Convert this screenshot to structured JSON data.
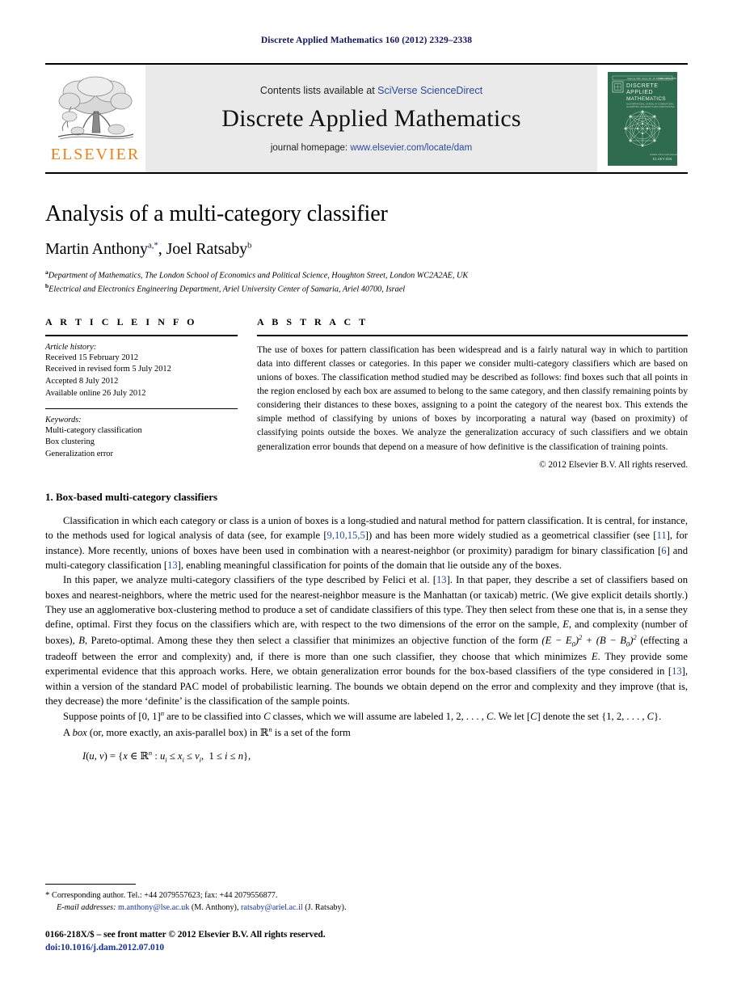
{
  "running_head": "Discrete Applied Mathematics 160 (2012) 2329–2338",
  "masthead": {
    "publisher_name": "ELSEVIER",
    "publisher_logo_icon": "elsevier-tree-icon",
    "contents_prefix": "Contents lists available at ",
    "contents_link": "SciVerse ScienceDirect",
    "journal_name": "Discrete Applied Mathematics",
    "homepage_prefix": "journal homepage: ",
    "homepage_link": "www.elsevier.com/locate/dam",
    "cover": {
      "issue_line": "Volume 160, Issue 16, 15 October 2012",
      "issn_line": "ISSN 0166-218X",
      "title_line1": "DISCRETE",
      "title_line2": "APPLIED",
      "title_line3": "MATHEMATICS",
      "subtitle": "AN INTERNATIONAL JOURNAL OF COMBINATORIAL ALGORITHMS, INFORMATICS AND COMPUTATIONAL SCIENCES",
      "footer": "ELSEVIER",
      "graphic_icon": "graph-network-icon",
      "bg_color": "#2f6b4f"
    }
  },
  "article": {
    "title": "Analysis of a multi-category classifier",
    "authors": [
      {
        "name": "Martin Anthony",
        "marks": "a,*"
      },
      {
        "name": "Joel Ratsaby",
        "marks": "b"
      }
    ],
    "authors_separator": ", ",
    "affiliations": [
      {
        "mark": "a",
        "text": "Department of Mathematics, The London School of Economics and Political Science, Houghton Street, London WC2A2AE, UK"
      },
      {
        "mark": "b",
        "text": "Electrical and Electronics Engineering Department, Ariel University Center of Samaria, Ariel 40700, Israel"
      }
    ]
  },
  "article_info": {
    "label": "A R T I C L E   I N F O",
    "history_label": "Article history:",
    "history": [
      "Received 15 February 2012",
      "Received in revised form 5 July 2012",
      "Accepted 8 July 2012",
      "Available online 26 July 2012"
    ],
    "keywords_label": "Keywords:",
    "keywords": [
      "Multi-category classification",
      "Box clustering",
      "Generalization error"
    ]
  },
  "abstract": {
    "label": "A B S T R A C T",
    "text": "The use of boxes for pattern classification has been widespread and is a fairly natural way in which to partition data into different classes or categories. In this paper we consider multi-category classifiers which are based on unions of boxes. The classification method studied may be described as follows: find boxes such that all points in the region enclosed by each box are assumed to belong to the same category, and then classify remaining points by considering their distances to these boxes, assigning to a point the category of the nearest box. This extends the simple method of classifying by unions of boxes by incorporating a natural way (based on proximity) of classifying points outside the boxes. We analyze the generalization accuracy of such classifiers and we obtain generalization error bounds that depend on a measure of how definitive is the classification of training points.",
    "copyright": "© 2012 Elsevier B.V. All rights reserved."
  },
  "body": {
    "section_number": "1.",
    "section_title": "Box-based multi-category classifiers",
    "paragraphs": {
      "p1_a": "Classification in which each category or class is a union of boxes is a long-studied and natural method for pattern classification. It is central, for instance, to the methods used for logical analysis of data (see, for example [",
      "p1_cite1": "9,10,15,5",
      "p1_b": "]) and has been more widely studied as a geometrical classifier (see [",
      "p1_cite2": "11",
      "p1_c": "], for instance). More recently, unions of boxes have been used in combination with a nearest-neighbor (or proximity) paradigm for binary classification [",
      "p1_cite3": "6",
      "p1_d": "] and multi-category classification [",
      "p1_cite4": "13",
      "p1_e": "], enabling meaningful classification for points of the domain that lie outside any of the boxes.",
      "p2_a": "In this paper, we analyze multi-category classifiers of the type described by Felici et al. [",
      "p2_cite1": "13",
      "p2_b": "]. In that paper, they describe a set of classifiers based on boxes and nearest-neighbors, where the metric used for the nearest-neighbor measure is the Manhattan (or taxicab) metric. (We give explicit details shortly.) They use an agglomerative box-clustering method to produce a set of candidate classifiers of this type. They then select from these one that is, in a sense they define, optimal. First they focus on the classifiers which are, with respect to the two dimensions of the error on the sample, ",
      "p2_var_E1": "E",
      "p2_c": ", and complexity (number of boxes), ",
      "p2_var_B1": "B",
      "p2_d": ", Pareto-optimal. Among these they then select a classifier that minimizes an objective function of the form ",
      "p2_formula": "(E − E0)2 + (B − B0)2",
      "p2_e": " (effecting a tradeoff between the error and complexity) and, if there is more than one such classifier, they choose that which minimizes ",
      "p2_var_E2": "E",
      "p2_f": ". They provide some experimental evidence that this approach works. Here, we obtain generalization error bounds for the box-based classifiers of the type considered in [",
      "p2_cite2": "13",
      "p2_g": "], within a version of the standard PAC model of probabilistic learning. The bounds we obtain depend on the error and complexity and they improve (that is, they decrease) the more ‘definite’ is the classification of the sample points.",
      "p3_a": "Suppose points of [0, 1]",
      "p3_sup_n": "n",
      "p3_b": " are to be classified into ",
      "p3_var_C": "C",
      "p3_c": " classes, which we will assume are labeled 1, 2, . . . , ",
      "p3_var_C2": "C",
      "p3_d": ". We let [",
      "p3_var_C3": "C",
      "p3_e": "] denote the set {1, 2, . . . , ",
      "p3_var_C4": "C",
      "p3_f": "}.",
      "p4_a": "A ",
      "p4_em": "box",
      "p4_b": " (or, more exactly, an axis-parallel box) in ",
      "p4_rn": "ℝn",
      "p4_c": " is a set of the form"
    },
    "equation": "I(u, v) = {x ∈ ℝn : ui ≤ xi ≤ vi,  1 ≤ i ≤ n},"
  },
  "footer": {
    "corresponding_star": "*",
    "corresponding_text": "Corresponding author. Tel.: +44 2079557623; fax: +44 2079556877.",
    "email_label": "E-mail addresses:",
    "emails": [
      {
        "address": "m.anthony@lse.ac.uk",
        "owner": "(M. Anthony)"
      },
      {
        "address": "ratsaby@ariel.ac.il",
        "owner": "(J. Ratsaby)"
      }
    ],
    "issn_line": "0166-218X/$ – see front matter © 2012 Elsevier B.V. All rights reserved.",
    "doi_line": "doi:10.1016/j.dam.2012.07.010"
  },
  "colors": {
    "link_blue": "#2b4a9b",
    "running_head_navy": "#14145a",
    "elsevier_orange": "#ee8019",
    "cover_green": "#2f6b4f",
    "banner_grey": "#eaeaea"
  }
}
